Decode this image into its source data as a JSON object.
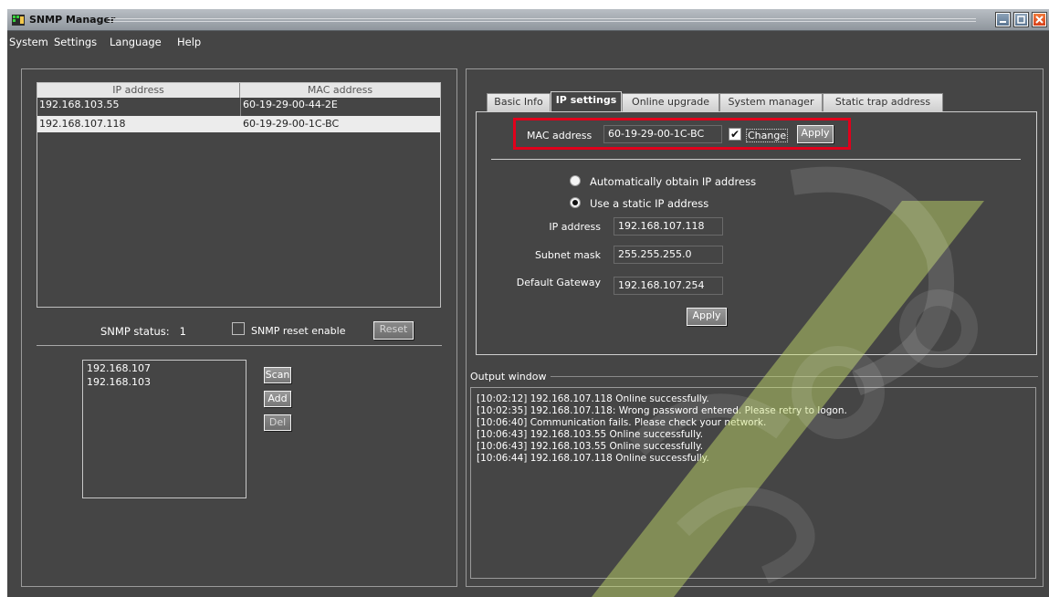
{
  "window": {
    "title": "SNMP Manager"
  },
  "menu": [
    "System",
    "Settings",
    "Language",
    "Help"
  ],
  "device_table": {
    "columns": [
      "IP address",
      "MAC address"
    ],
    "rows": [
      {
        "ip": "192.168.103.55",
        "mac": "60-19-29-00-44-2E"
      },
      {
        "ip": "192.168.107.118",
        "mac": "60-19-29-00-1C-BC"
      }
    ]
  },
  "snmp": {
    "status_label": "SNMP status:",
    "status_value": "1",
    "reset_enable_label": "SNMP reset enable",
    "reset_label": "Reset"
  },
  "subnets": [
    "192.168.107",
    "192.168.103"
  ],
  "subnet_buttons": {
    "scan": "Scan",
    "add": "Add",
    "del": "Del"
  },
  "tabs": [
    "Basic Info",
    "IP settings",
    "Online upgrade",
    "System manager",
    "Static trap address"
  ],
  "active_tab": "IP settings",
  "ip_settings": {
    "mac_label": "MAC address",
    "mac_value": "60-19-29-00-1C-BC",
    "change_label": "Change",
    "change_checked": true,
    "mac_apply_label": "Apply",
    "auto_label": "Automatically obtain IP address",
    "static_label": "Use a static IP address",
    "ip_label": "IP address",
    "ip_value": "192.168.107.118",
    "mask_label": "Subnet mask",
    "mask_value": "255.255.255.0",
    "gateway_label": "Default Gateway",
    "gateway_value": "192.168.107.254",
    "apply_label": "Apply"
  },
  "output": {
    "title": "Output window",
    "lines": [
      "[10:02:12]  192.168.107.118 Online successfully.",
      "[10:02:35]  192.168.107.118: Wrong password entered. Please retry to logon.",
      "[10:06:40]    Communication fails. Please check your network.",
      "[10:06:43]  192.168.103.55 Online successfully.",
      "[10:06:43]  192.168.103.55 Online successfully.",
      "[10:06:44]  192.168.107.118 Online successfully."
    ]
  },
  "colors": {
    "background": "#454545",
    "highlight": "#e1001b",
    "row_selected": "#ececec"
  },
  "icons": [
    "app-icon",
    "minimize-icon",
    "maximize-icon",
    "close-icon",
    "check-icon"
  ]
}
